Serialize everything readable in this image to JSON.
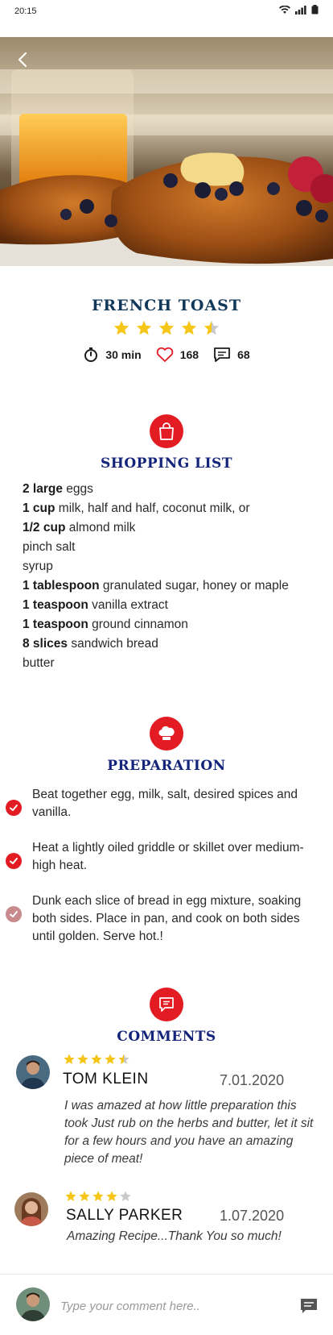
{
  "status_bar": {
    "time": "20:15"
  },
  "recipe": {
    "title": "FRENCH TOAST",
    "rating": 4.5,
    "time": "30 min",
    "likes": "168",
    "comments_count": "68"
  },
  "shopping": {
    "title": "SHOPPING LIST",
    "items": [
      {
        "qty": "2 large",
        "text": " eggs"
      },
      {
        "qty": "1 cup",
        "text": " milk, half and half, coconut milk, or"
      },
      {
        "qty": "1/2 cup",
        "text": " almond milk"
      },
      {
        "qty": "",
        "text": "pinch salt"
      },
      {
        "qty": "",
        "text": "syrup"
      },
      {
        "qty": "1 tablespoon",
        "text": " granulated sugar, honey or maple"
      },
      {
        "qty": "1 teaspoon",
        "text": " vanilla extract"
      },
      {
        "qty": "1 teaspoon",
        "text": " ground cinnamon"
      },
      {
        "qty": "8 slices",
        "text": " sandwich bread"
      },
      {
        "qty": "",
        "text": "butter"
      }
    ]
  },
  "preparation": {
    "title": "PREPARATION",
    "steps": [
      {
        "text": "Beat together egg, milk, salt, desired spices and vanilla.",
        "done": true
      },
      {
        "text": "Heat a lightly oiled griddle or skillet over medium-high heat.",
        "done": true
      },
      {
        "text": "Dunk each slice of bread in egg mixture, soaking both sides. Place in pan, and cook on both sides until golden. Serve hot.!",
        "done": false
      }
    ]
  },
  "comments": {
    "title": "COMMENTS",
    "items": [
      {
        "name": "TOM KLEIN",
        "date": "7.01.2020",
        "rating": 4.5,
        "text": "I was amazed at how little preparation this took Just rub on the herbs and butter, let it sit for a few hours and you have an amazing piece of meat!"
      },
      {
        "name": "SALLY PARKER",
        "date": "1.07.2020",
        "rating": 4,
        "text": "Amazing Recipe...Thank You so much!"
      }
    ]
  },
  "comment_bar": {
    "placeholder": "Type your comment here.."
  },
  "colors": {
    "accent": "#e31b23",
    "title": "#14247a",
    "star": "#f5c518",
    "star_empty": "#c9c9c9"
  }
}
